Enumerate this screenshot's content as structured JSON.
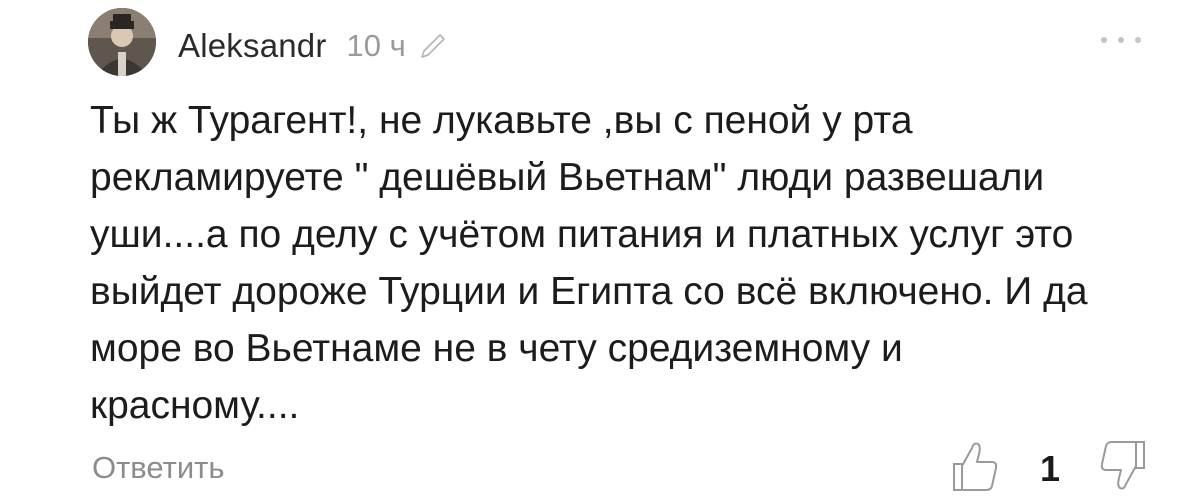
{
  "comment": {
    "author": "Aleksandr",
    "time": "10 ч",
    "text": "Ты ж Турагент!, не лукавьте ,вы с пеной у рта\nрекламируете \" дешёвый Вьетнам\" люди развешали\nуши....а по делу с учётом питания и платных услуг это\nвыйдет дороже Турции и Египта со всё включено. И да\nморе во Вьетнаме не в чету средиземному и\nкрасному....",
    "reply_label": "Ответить",
    "likes": "1"
  },
  "icons": {
    "avatar": "user-avatar-photo",
    "edit": "pencil-icon",
    "more": "more-dots-icon",
    "like": "thumbs-up-icon",
    "dislike": "thumbs-down-icon"
  }
}
